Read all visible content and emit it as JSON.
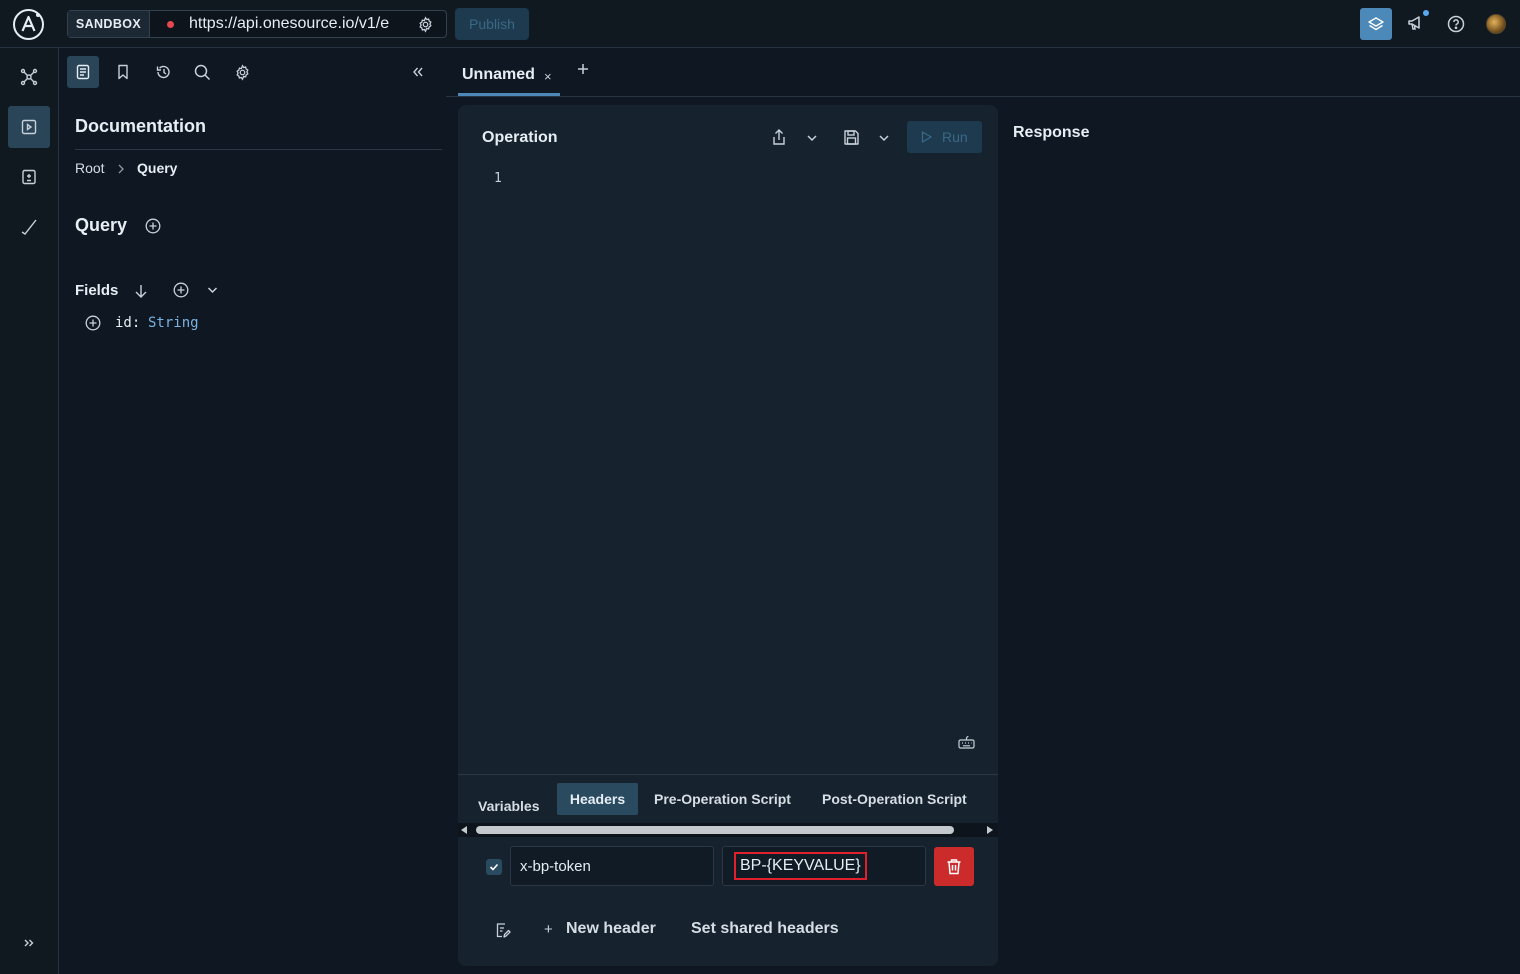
{
  "topbar": {
    "logo_icon": "apollo-logo-icon",
    "sandbox_label": "SANDBOX",
    "endpoint_url": "https://api.onesource.io/v1/e",
    "publish_label": "Publish",
    "status_color": "#e5484d",
    "accent_color": "#4c89b8"
  },
  "rail": {
    "items": [
      "schema-icon",
      "explorer-icon",
      "checks-icon",
      "launches-icon"
    ],
    "active": "explorer-icon",
    "expand_icon": "expand-icon"
  },
  "docs": {
    "title": "Documentation",
    "breadcrumb": [
      "Root",
      "Query"
    ],
    "type_heading": "Query",
    "fields_label": "Fields",
    "fields": [
      {
        "name": "id:",
        "type": "String"
      }
    ]
  },
  "tabs": {
    "items": [
      {
        "label": "Unnamed",
        "close": "×"
      }
    ],
    "new_tab_label": "+"
  },
  "operation": {
    "title": "Operation",
    "run_label": "Run",
    "line_numbers": [
      "1"
    ]
  },
  "bottom_tabs": {
    "items": [
      "Variables",
      "Headers",
      "Pre-Operation Script",
      "Post-Operation Script"
    ],
    "active": "Headers"
  },
  "headers": {
    "rows": [
      {
        "enabled": true,
        "key": "x-bp-token",
        "value": "BP-{KEYVALUE}"
      }
    ],
    "new_header_plus": "+",
    "new_header_label": "New header",
    "shared_headers_label": "Set shared headers"
  },
  "response": {
    "title": "Response"
  }
}
